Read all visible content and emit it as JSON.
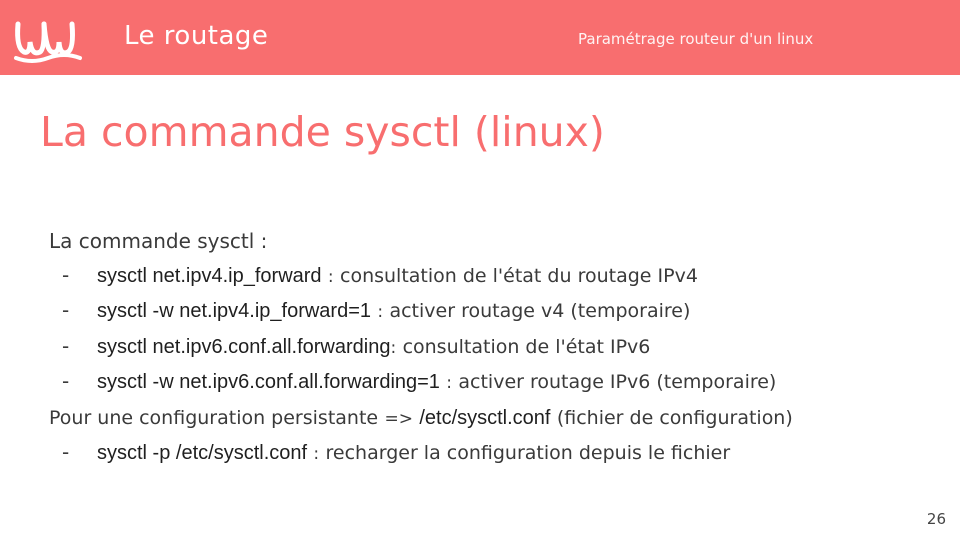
{
  "header": {
    "title": "Le routage",
    "subtitle": "Paramétrage routeur d'un linux",
    "logo_icon": "wave-logo-icon"
  },
  "slide": {
    "title": "La commande sysctl (linux)",
    "intro": "La commande sysctl :",
    "bullets1": [
      {
        "dash": "-",
        "command": "sysctl net.ipv4.ip_forward",
        "sep": ":",
        "text": "consultation de l'état du routage IPv4"
      },
      {
        "dash": "-",
        "command": "sysctl -w net.ipv4.ip_forward=1",
        "sep": ":",
        "text": "activer routage v4 (temporaire)"
      },
      {
        "dash": "-",
        "command": "sysctl net.ipv6.conf.all.forwarding",
        "sep": ":",
        "text": "consultation de l'état IPv6"
      },
      {
        "dash": "-",
        "command": "sysctl -w net.ipv6.conf.all.forwarding=1",
        "sep": ":",
        "text": "activer routage IPv6 (temporaire)"
      }
    ],
    "persist": {
      "prefix": "Pour une configuration persistante",
      "arrow": "=>",
      "file": "/etc/sysctl.conf",
      "suffix": "(fichier de configuration)"
    },
    "bullets2": [
      {
        "dash": "-",
        "command": "sysctl -p /etc/sysctl.conf",
        "sep": ":",
        "text": "recharger la configuration depuis le fichier"
      }
    ]
  },
  "page_number": "26",
  "colors": {
    "accent": "#f86e6f",
    "text": "#3a3a3a"
  }
}
